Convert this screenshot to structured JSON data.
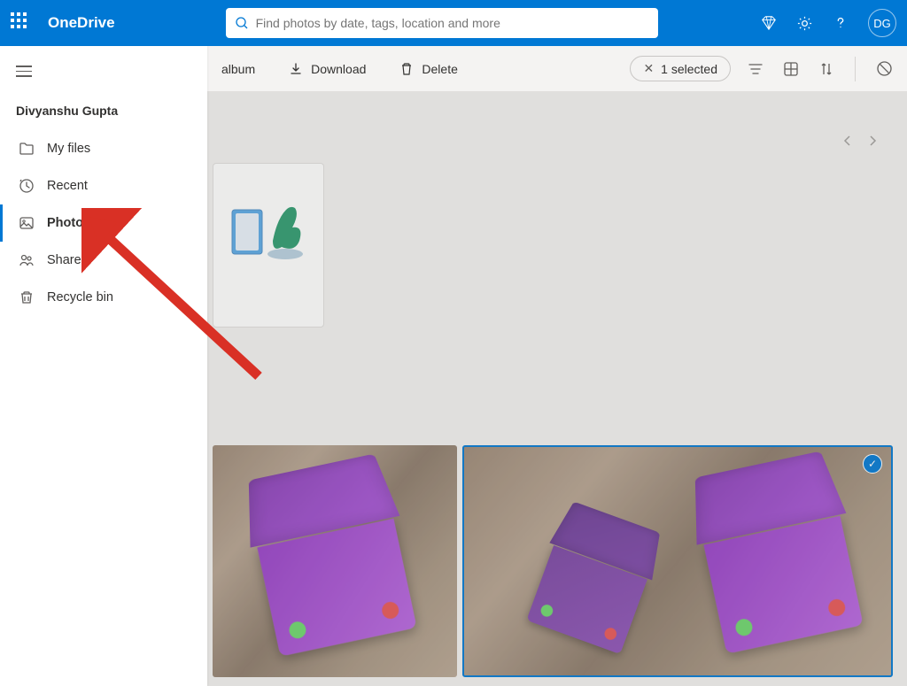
{
  "header": {
    "app_name": "OneDrive",
    "search_placeholder": "Find photos by date, tags, location and more",
    "avatar_initials": "DG"
  },
  "sidebar": {
    "user_name": "Divyanshu Gupta",
    "items": [
      {
        "label": "My files",
        "icon": "folder"
      },
      {
        "label": "Recent",
        "icon": "clock"
      },
      {
        "label": "Photos",
        "icon": "image",
        "active": true
      },
      {
        "label": "Shared",
        "icon": "people"
      },
      {
        "label": "Recycle bin",
        "icon": "trash"
      }
    ]
  },
  "toolbar": {
    "album_label": "album",
    "download_label": "Download",
    "delete_label": "Delete",
    "selected_label": "1 selected"
  },
  "colors": {
    "primary": "#0078d4"
  }
}
